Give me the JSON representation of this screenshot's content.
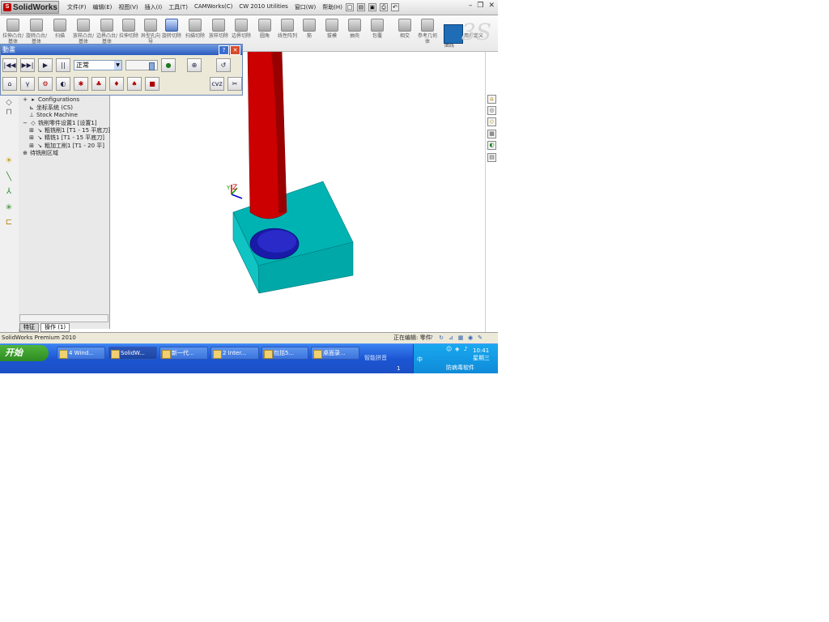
{
  "app": {
    "brand": "SolidWorks"
  },
  "menu": [
    "文件(F)",
    "编辑(E)",
    "视图(V)",
    "插入(I)",
    "工具(T)",
    "CAMWorks(C)",
    "CW 2010 Utilities",
    "窗口(W)",
    "帮助(H)"
  ],
  "window_controls": {
    "minimize": "–",
    "restore": "❐",
    "close": "✕"
  },
  "command_manager": [
    "拉伸凸台/基体",
    "旋转凸台/基体",
    "扫描",
    "放样凸台/基体",
    "边界凸台/基体",
    "拉伸切除",
    "异型孔向导",
    "旋转切除",
    "扫描切除",
    "放样切除",
    "边界切除",
    "圆角",
    "线性阵列",
    "筋",
    "拔模",
    "抽壳",
    "包覆",
    "相交",
    "参考几何体",
    "曲线",
    "用户定义"
  ],
  "sim_panel": {
    "title": "動畫",
    "speed_value": "正常",
    "help": "?",
    "close": "✕",
    "row1_buttons": [
      "|◀◀",
      "▶▶|",
      "▶",
      "||",
      "●"
    ],
    "row2_buttons": [
      "⌂",
      "γ",
      "⚙",
      "◐",
      "✱",
      "♣",
      "♦",
      "♠",
      "■"
    ],
    "row1_extra": [
      "⊕",
      "↺"
    ],
    "row2_extra": [
      "cvz",
      "✂"
    ]
  },
  "left_tools": [
    "◇",
    "⊓",
    "☀",
    "╲",
    "⅄",
    "✳",
    "⊏"
  ],
  "tree": [
    "Configurations",
    "坐标系统 (CS)",
    "Stock Machine",
    "铣削零件设置1 [设置1]",
    "粗铣削1 [T1 - 15 平底刀]",
    "精铣1 [T1 - 15 平底刀]",
    "粗加工削1 [T1 - 20 平]",
    "待铣削区域"
  ],
  "tree_tabs": [
    "特征",
    "操作 (1)"
  ],
  "status": {
    "left": "SolidWorks Premium 2010",
    "right": "正在编辑: 零件"
  },
  "status_icons": [
    "?",
    "↻",
    "⊿",
    "▦",
    "◉",
    "✎"
  ],
  "right_tools": [
    "⌂",
    "◎",
    "◇",
    "▦",
    "◐",
    "▤"
  ],
  "taskbar": {
    "start": "开始",
    "tasks": [
      "4 Wind...",
      "SolidW...",
      "新一代...",
      "2 Inter...",
      "包括5...",
      "桌面录..."
    ],
    "lang": "智能拼音",
    "lang2": "中 ",
    "page": "1",
    "clock_time": "10:41",
    "clock_day": "星期三",
    "security": "防病毒软件"
  },
  "colors": {
    "cylinder": "#cc0000",
    "block": "#00b3b3",
    "hole": "#1a1aa8",
    "taskbar": "#1c55d2",
    "start": "#2e8b22"
  }
}
